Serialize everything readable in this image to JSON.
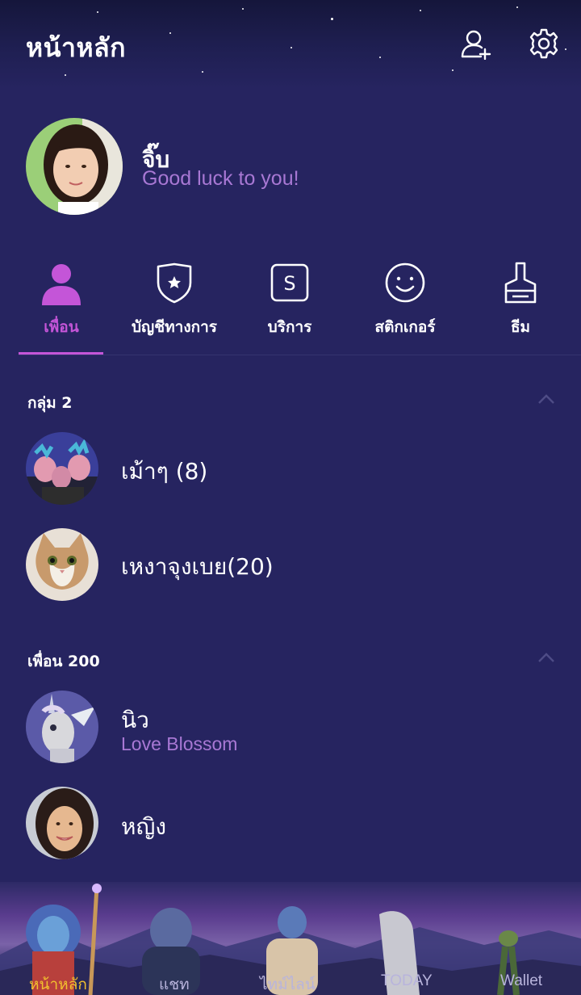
{
  "header": {
    "title": "หน้าหลัก",
    "add_friend_icon": "add-friend-icon",
    "settings_icon": "gear-icon"
  },
  "profile": {
    "name": "จิ๊บ",
    "status": "Good luck to you!"
  },
  "tabs": [
    {
      "label": "เพื่อน",
      "icon": "person-icon",
      "active": true
    },
    {
      "label": "บัญชีทางการ",
      "icon": "shield-star-icon",
      "active": false
    },
    {
      "label": "บริการ",
      "icon": "service-s-icon",
      "active": false
    },
    {
      "label": "สติกเกอร์",
      "icon": "smiley-icon",
      "active": false
    },
    {
      "label": "ธีม",
      "icon": "brush-icon",
      "active": false
    }
  ],
  "groups": {
    "header": "กลุ่ม 2",
    "items": [
      {
        "name": "เม้าๆ (8)"
      },
      {
        "name": "เหงาจุงเบย(20)"
      }
    ]
  },
  "friends": {
    "header": "เพื่อน 200",
    "items": [
      {
        "name": "นิว",
        "status": "Love Blossom"
      },
      {
        "name": "หญิง"
      }
    ]
  },
  "bottom_nav": [
    {
      "label": "หน้าหลัก",
      "active": true
    },
    {
      "label": "แชท"
    },
    {
      "label": "ไทม์ไลน์"
    },
    {
      "label": "TODAY"
    },
    {
      "label": "Wallet"
    }
  ],
  "colors": {
    "background": "#262460",
    "accent": "#c455d8",
    "status_text": "#a878d4",
    "active_nav": "#f2c02e"
  }
}
